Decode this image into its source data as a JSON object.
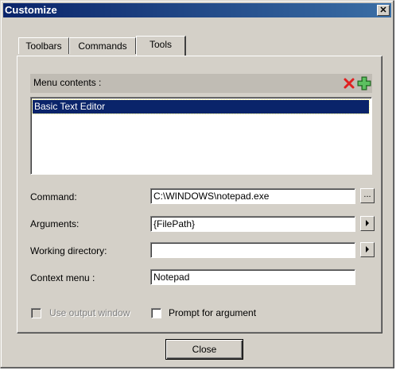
{
  "window": {
    "title": "Customize",
    "close_glyph": "✕"
  },
  "tabs": [
    {
      "label": "Toolbars",
      "active": false
    },
    {
      "label": "Commands",
      "active": false
    },
    {
      "label": "Tools",
      "active": true
    }
  ],
  "menu_contents": {
    "label": "Menu contents :",
    "delete_icon": "red-x-icon",
    "add_icon": "green-plus-icon",
    "items": [
      "Basic Text Editor"
    ],
    "selected_index": 0
  },
  "fields": {
    "command": {
      "label": "Command:",
      "value": "C:\\WINDOWS\\notepad.exe",
      "button": "..."
    },
    "arguments": {
      "label": "Arguments:",
      "value": "{FilePath}",
      "button": "▸"
    },
    "working_directory": {
      "label": "Working directory:",
      "value": "",
      "button": "▸"
    },
    "context_menu": {
      "label": "Context menu :",
      "value": "Notepad"
    }
  },
  "options": {
    "use_output_window": {
      "label": "Use output window",
      "checked": false,
      "enabled": false
    },
    "prompt_for_argument": {
      "label": "Prompt for argument",
      "checked": false,
      "enabled": true
    }
  },
  "footer": {
    "close_label": "Close"
  },
  "colors": {
    "titlebar": "#0a246a",
    "face": "#d4d0c8",
    "selection": "#0a246a",
    "delete_icon": "#e02020",
    "add_icon": "#3ca040"
  }
}
